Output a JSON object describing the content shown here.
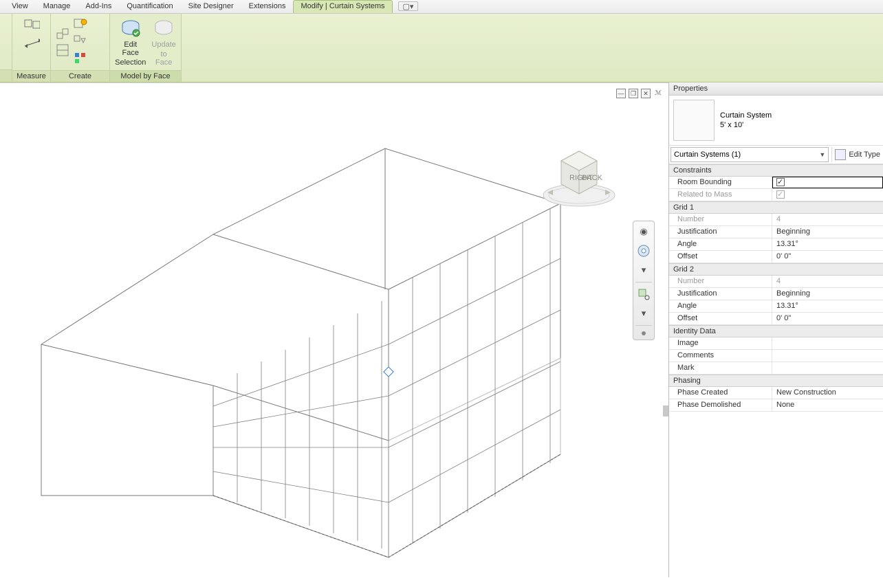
{
  "tabs": {
    "items": [
      "View",
      "Manage",
      "Add-Ins",
      "Quantification",
      "Site Designer",
      "Extensions",
      "Modify | Curtain Systems"
    ],
    "active_index": 6
  },
  "ribbon": {
    "panels": [
      {
        "title": "Measure",
        "items": []
      },
      {
        "title": "Create",
        "items": []
      },
      {
        "title": "Model by Face",
        "items": [
          {
            "label_line1": "Edit Face",
            "label_line2": "Selection",
            "enabled": true
          },
          {
            "label_line1": "Update",
            "label_line2": "to Face",
            "enabled": false
          }
        ]
      }
    ]
  },
  "viewcube": {
    "face_right": "RIGHT",
    "face_back": "BACK"
  },
  "properties": {
    "title": "Properties",
    "type_name_line1": "Curtain System",
    "type_name_line2": "5' x 10'",
    "selector": "Curtain Systems (1)",
    "edit_type": "Edit Type",
    "groups": [
      {
        "name": "Constraints",
        "rows": [
          {
            "k": "Room Bounding",
            "v": "__check_on__",
            "selected": true
          },
          {
            "k": "Related to Mass",
            "v": "__check_on_dis__",
            "disabled": true
          }
        ]
      },
      {
        "name": "Grid 1",
        "rows": [
          {
            "k": "Number",
            "v": "4",
            "disabled": true
          },
          {
            "k": "Justification",
            "v": "Beginning"
          },
          {
            "k": "Angle",
            "v": "13.31°"
          },
          {
            "k": "Offset",
            "v": "0'  0\""
          }
        ]
      },
      {
        "name": "Grid 2",
        "rows": [
          {
            "k": "Number",
            "v": "4",
            "disabled": true
          },
          {
            "k": "Justification",
            "v": "Beginning"
          },
          {
            "k": "Angle",
            "v": "13.31°"
          },
          {
            "k": "Offset",
            "v": "0'  0\""
          }
        ]
      },
      {
        "name": "Identity Data",
        "rows": [
          {
            "k": "Image",
            "v": ""
          },
          {
            "k": "Comments",
            "v": ""
          },
          {
            "k": "Mark",
            "v": ""
          }
        ]
      },
      {
        "name": "Phasing",
        "rows": [
          {
            "k": "Phase Created",
            "v": "New Construction"
          },
          {
            "k": "Phase Demolished",
            "v": "None"
          }
        ]
      }
    ]
  }
}
